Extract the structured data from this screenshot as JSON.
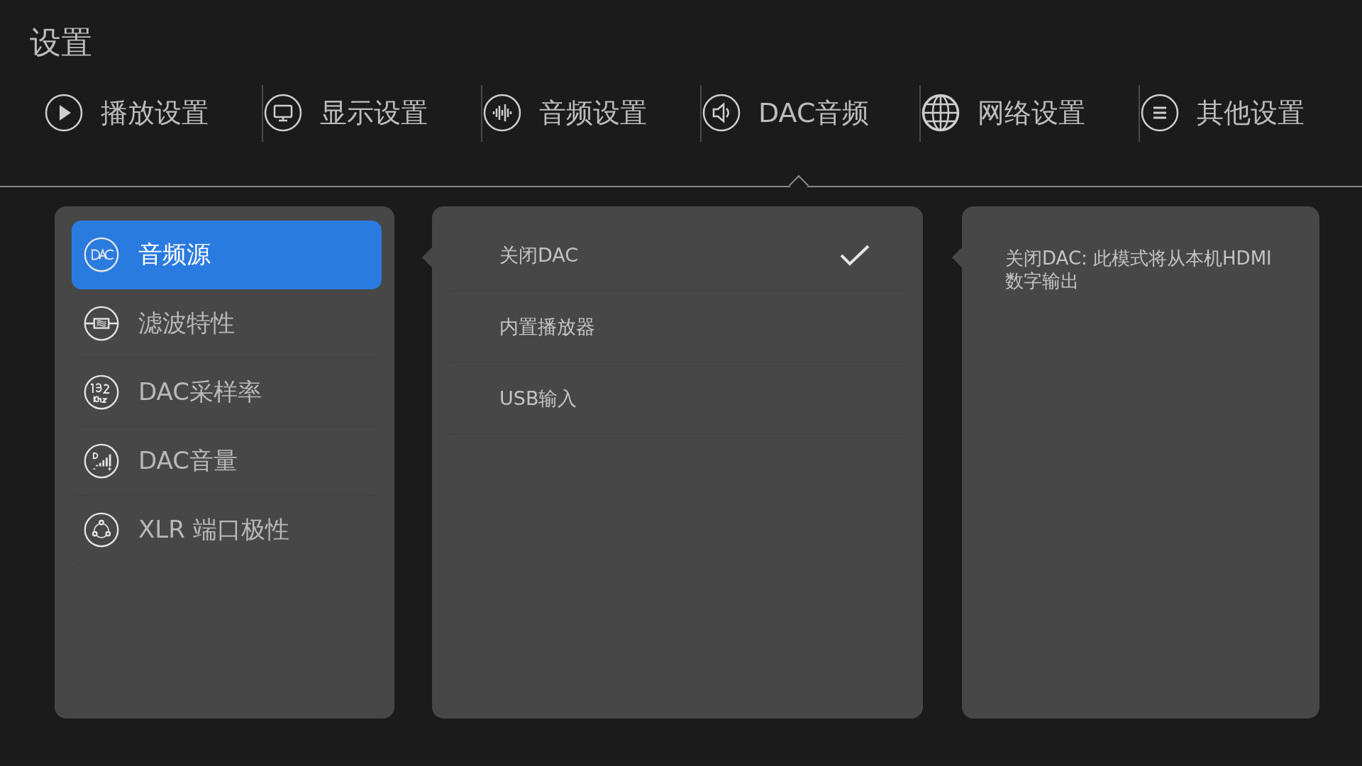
{
  "title": "设置",
  "tabs": [
    {
      "label": "播放设置",
      "kind": "play",
      "selected": false
    },
    {
      "label": "显示设置",
      "kind": "display",
      "selected": false
    },
    {
      "label": "音频设置",
      "kind": "audio",
      "selected": false
    },
    {
      "label": "DAC音频",
      "kind": "speaker",
      "selected": true
    },
    {
      "label": "网络设置",
      "kind": "globe",
      "selected": false
    },
    {
      "label": "其他设置",
      "kind": "list",
      "selected": false
    }
  ],
  "menu": [
    {
      "label": "音频源",
      "kind": "dac",
      "selected": true
    },
    {
      "label": "滤波特性",
      "kind": "filter",
      "selected": false
    },
    {
      "label": "DAC采样率",
      "kind": "rate",
      "selected": false
    },
    {
      "label": "DAC音量",
      "kind": "volume",
      "selected": false
    },
    {
      "label": "XLR 端口极性",
      "kind": "xlr",
      "selected": false
    }
  ],
  "options": [
    {
      "label": "关闭DAC",
      "selected": true
    },
    {
      "label": "内置播放器",
      "selected": false
    },
    {
      "label": "USB输入",
      "selected": false
    }
  ],
  "description": "关闭DAC: 此模式将从本机HDMI数字输出"
}
